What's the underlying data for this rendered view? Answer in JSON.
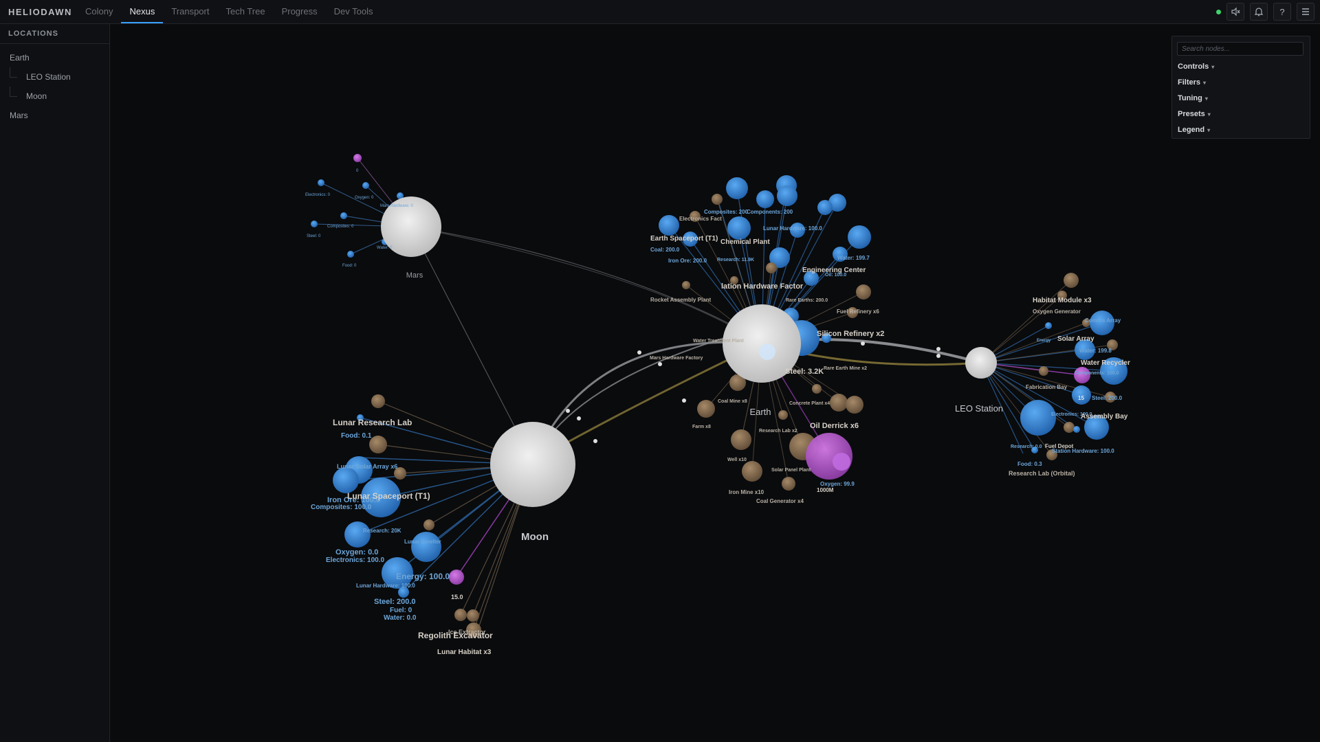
{
  "app": {
    "brand": "HELIODAWN"
  },
  "tabs": [
    "Colony",
    "Nexus",
    "Transport",
    "Tech Tree",
    "Progress",
    "Dev Tools"
  ],
  "active_tab": "Nexus",
  "top_icons": [
    "status-dot",
    "mute-icon",
    "bell-icon",
    "help-icon",
    "menu-icon"
  ],
  "sidebar": {
    "title": "LOCATIONS",
    "items": [
      {
        "label": "Earth"
      },
      {
        "label": "LEO Station"
      },
      {
        "label": "Moon"
      },
      {
        "label": "Mars"
      }
    ]
  },
  "panel": {
    "search_placeholder": "Search nodes...",
    "items": [
      "Controls",
      "Filters",
      "Tuning",
      "Presets",
      "Legend"
    ]
  },
  "colors": {
    "resource": "#3a8be0",
    "building": "#8a7258",
    "special": "#b24fc9",
    "hub": "#d9d9d9",
    "link_gold": "#8a7a3a"
  },
  "hubs": {
    "earth": "Earth",
    "moon": "Moon",
    "mars": "Mars",
    "leo": "LEO Station"
  },
  "labels": {
    "earth": [
      "Composites: 200",
      "Components: 200",
      "Electronics Fact",
      "Lunar Hardware: 100.0",
      "Earth Spaceport (T1)",
      "Chemical Plant",
      "Coal: 200.0",
      "Iron Ore: 200.0",
      "Research: 11.9K",
      "Water: 199.7",
      "Engineering Center",
      "Oil: 100.0",
      "lation Hardware Factor",
      "Rocket Assembly Plant",
      "Rare Earths: 200.0",
      "Fuel Refinery x6",
      "Silicon Refinery x2",
      "Mars Hardware Factory",
      "Water Treatment Plant",
      "Steel: 3.2K",
      "Rare Earth Mine x2",
      "Coal Mine x8",
      "Concrete Plant x4",
      "Oil Derrick x6",
      "Earth",
      "Farm x8",
      "Research Lab x2",
      "Well x10",
      "Solar Panel Plant",
      "Oxygen: 99.9",
      "1000M",
      "Iron Mine x10",
      "Coal Generator x4"
    ],
    "moon": [
      "Lunar Research Lab",
      "Food: 0.1",
      "Lunar Solar Array x6",
      "Iron Ore: 100.0",
      "Lunar Spaceport (T1)",
      "Composites: 100.0",
      "Research: 20K",
      "Lunar Smelter",
      "Oxygen: 0.0",
      "Electronics: 100.0",
      "Energy: 100.0",
      "Lunar Hardware: 100.0",
      "15.0",
      "Steel: 200.0",
      "Fuel: 0",
      "Water: 0.0",
      "Ice Extractor",
      "Regolith Excavator",
      "Lunar Habitat x3",
      "Moon"
    ],
    "leo": [
      "Habitat Module x3",
      "Oxygen Generator",
      "Comms Array",
      "Energy",
      "Solar Array",
      "Water: 199.8",
      "Water Recycler",
      "Components: 100.0",
      "Fabrication Bay",
      "15",
      "Steel: 200.0",
      "Electronics: 100.0",
      "Assembly Bay",
      "Research: 0.0",
      "Fuel Depot",
      "Station Hardware: 100.0",
      "Food: 0.3",
      "Research Lab (Orbital)",
      "LEO Station"
    ],
    "mars": [
      "Electronics: 0",
      "Oxygen: 0",
      "Mars Hardware: 0",
      "Composites: 0",
      "Steel: 0",
      "Water: 0",
      "Food: 0",
      "0",
      "Mars"
    ]
  }
}
